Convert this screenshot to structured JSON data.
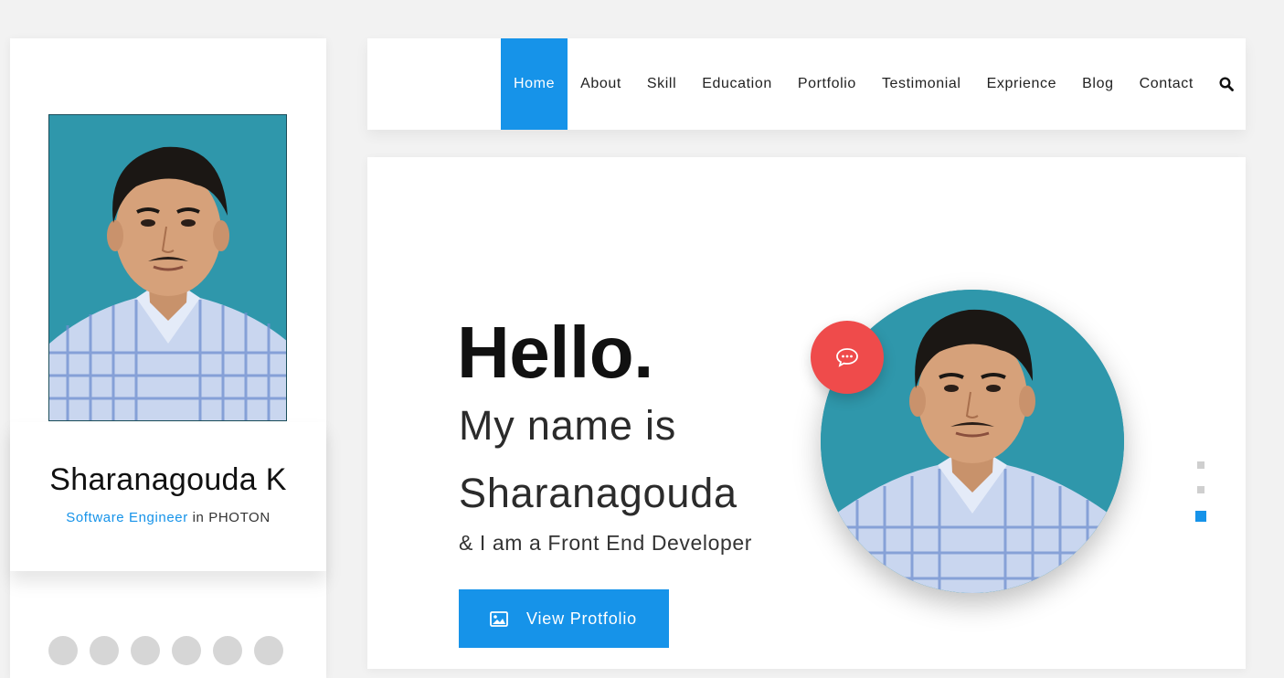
{
  "profile": {
    "name": "Sharanagouda K",
    "role_title": "Software Engineer",
    "role_connector": " in ",
    "company": "PHOTON",
    "photo_icon": "person-photo",
    "social_icons": [
      "facebook-icon",
      "twitter-icon",
      "linkedin-icon",
      "instagram-icon",
      "github-icon",
      "dribbble-icon"
    ]
  },
  "nav": {
    "items": [
      {
        "label": "Home",
        "active": true
      },
      {
        "label": "About"
      },
      {
        "label": "Skill"
      },
      {
        "label": "Education"
      },
      {
        "label": "Portfolio"
      },
      {
        "label": "Testimonial"
      },
      {
        "label": "Exprience"
      },
      {
        "label": "Blog"
      },
      {
        "label": "Contact"
      }
    ],
    "search_icon": "search-icon"
  },
  "hero": {
    "greeting": "Hello.",
    "line1": "My name is",
    "line2": "Sharanagouda",
    "subtitle": "& I am a Front End Developer",
    "button_label": "View Protfolio",
    "button_icon": "image-icon",
    "chat_icon": "chat-icon",
    "slider_active_index": 2,
    "slider_count": 3
  },
  "colors": {
    "accent": "#1693e9",
    "chat_badge": "#ef4b4b",
    "background": "#f2f2f2"
  }
}
